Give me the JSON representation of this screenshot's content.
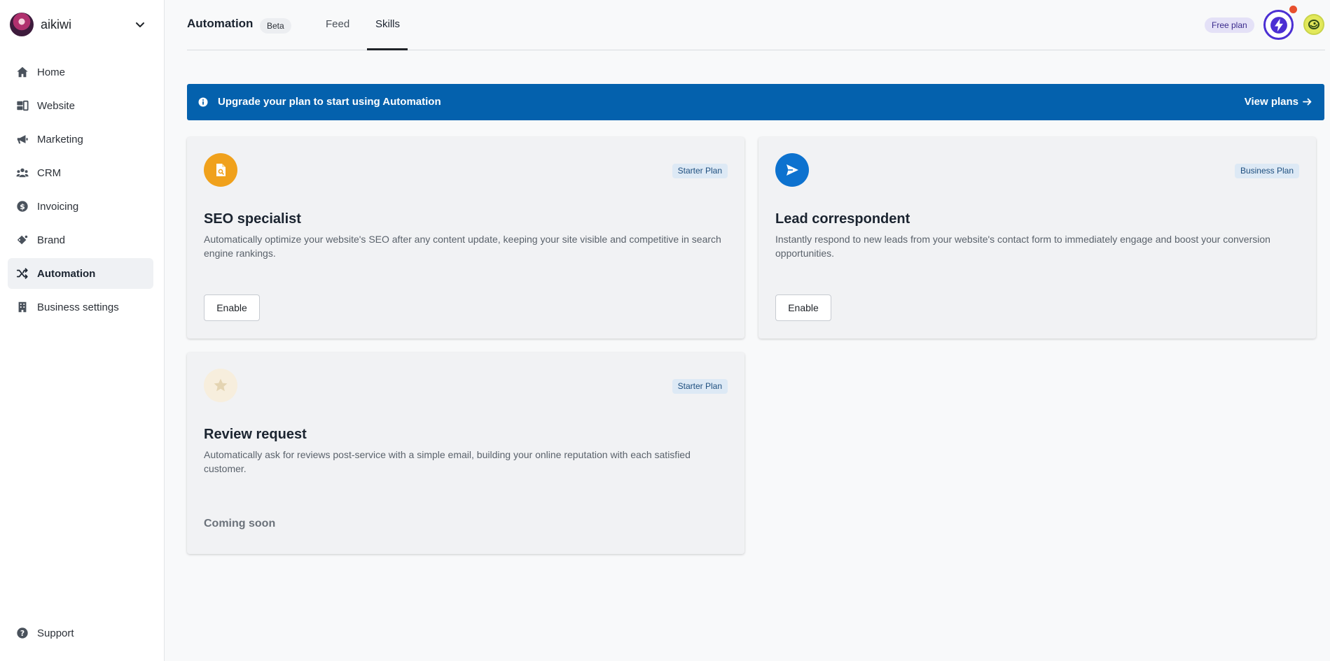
{
  "sidebar": {
    "business_name": "aikiwi",
    "items": [
      {
        "label": "Home",
        "icon": "home-icon"
      },
      {
        "label": "Website",
        "icon": "website-icon"
      },
      {
        "label": "Marketing",
        "icon": "megaphone-icon"
      },
      {
        "label": "CRM",
        "icon": "people-icon"
      },
      {
        "label": "Invoicing",
        "icon": "dollar-icon"
      },
      {
        "label": "Brand",
        "icon": "gem-icon"
      },
      {
        "label": "Automation",
        "icon": "shuffle-icon",
        "active": true
      },
      {
        "label": "Business settings",
        "icon": "building-icon"
      }
    ],
    "support_label": "Support"
  },
  "header": {
    "title": "Automation",
    "beta_label": "Beta",
    "tabs": [
      {
        "label": "Feed"
      },
      {
        "label": "Skills",
        "active": true
      }
    ],
    "plan_label": "Free plan"
  },
  "banner": {
    "text": "Upgrade your plan to start using Automation",
    "link_label": "View plans",
    "color": "#0461ad"
  },
  "cards": [
    {
      "title": "SEO specialist",
      "plan": "Starter Plan",
      "description": "Automatically optimize your website's SEO after any content update, keeping your site visible and competitive in search engine rankings.",
      "action_label": "Enable",
      "icon": "document-search-icon",
      "icon_color": "#f0a11c"
    },
    {
      "title": "Lead correspondent",
      "plan": "Business Plan",
      "description": "Instantly respond to new leads from your website's contact form to immediately engage and boost your conversion opportunities.",
      "action_label": "Enable",
      "icon": "send-icon",
      "icon_color": "#0d72cf"
    },
    {
      "title": "Review request",
      "plan": "Starter Plan",
      "description": "Automatically ask for reviews post-service with a simple email, building your online reputation with each satisfied customer.",
      "status_label": "Coming soon",
      "icon": "star-icon",
      "icon_color": "#f7eedd"
    }
  ]
}
